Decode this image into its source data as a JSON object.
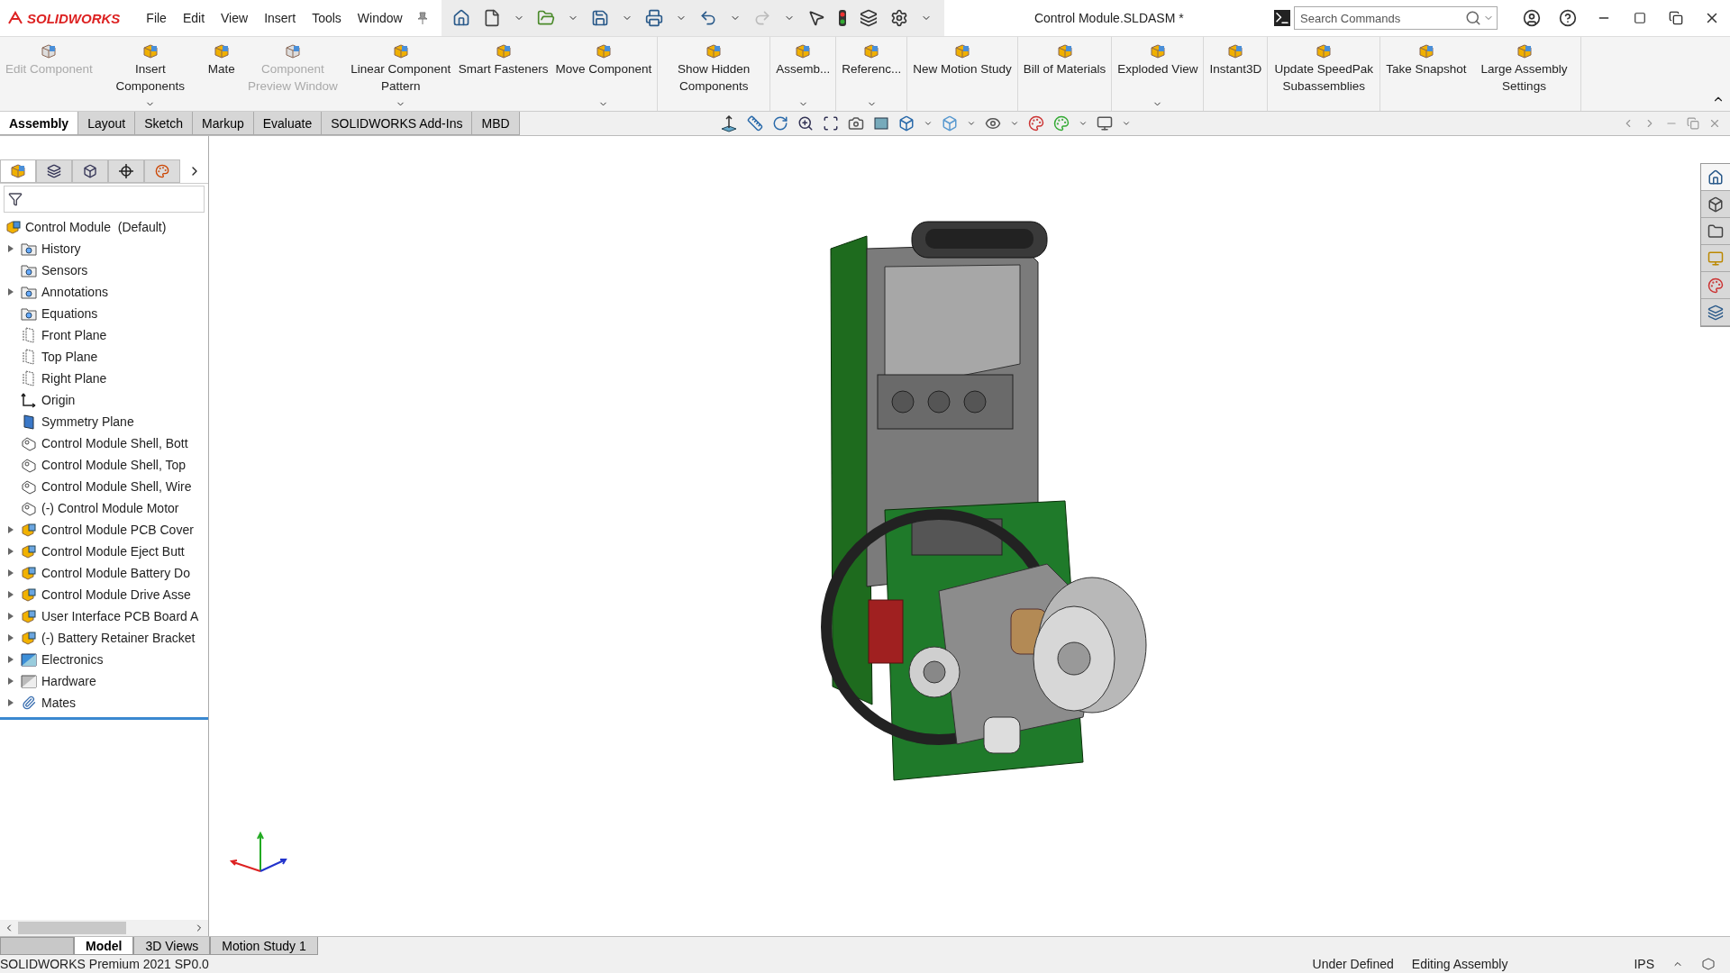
{
  "app": {
    "logo": "SOLIDWORKS",
    "menu": [
      "File",
      "Edit",
      "View",
      "Insert",
      "Tools",
      "Window"
    ],
    "title": "Control Module.SLDASM *"
  },
  "search": {
    "placeholder": "Search Commands"
  },
  "ribbon": [
    [
      {
        "label": "Edit Component",
        "disabled": true,
        "dropdown": false
      },
      {
        "label": "Insert Components",
        "disabled": false,
        "dropdown": true
      },
      {
        "label": "Mate",
        "disabled": false,
        "dropdown": false
      },
      {
        "label": "Component Preview Window",
        "disabled": true,
        "dropdown": false
      },
      {
        "label": "Linear Component Pattern",
        "disabled": false,
        "dropdown": true
      },
      {
        "label": "Smart Fasteners",
        "disabled": false,
        "dropdown": false
      },
      {
        "label": "Move Component",
        "disabled": false,
        "dropdown": true
      }
    ],
    [
      {
        "label": "Show Hidden Components",
        "disabled": false,
        "dropdown": false
      }
    ],
    [
      {
        "label": "Assemb...",
        "disabled": false,
        "dropdown": true
      }
    ],
    [
      {
        "label": "Referenc...",
        "disabled": false,
        "dropdown": true
      }
    ],
    [
      {
        "label": "New Motion Study",
        "disabled": false,
        "dropdown": false
      }
    ],
    [
      {
        "label": "Bill of Materials",
        "disabled": false,
        "dropdown": false
      }
    ],
    [
      {
        "label": "Exploded View",
        "disabled": false,
        "dropdown": true
      }
    ],
    [
      {
        "label": "Instant3D",
        "disabled": false,
        "dropdown": false
      }
    ],
    [
      {
        "label": "Update SpeedPak Subassemblies",
        "disabled": false,
        "dropdown": false
      }
    ],
    [
      {
        "label": "Take Snapshot",
        "disabled": false,
        "dropdown": false
      },
      {
        "label": "Large Assembly Settings",
        "disabled": false,
        "dropdown": false
      }
    ]
  ],
  "tabs": [
    {
      "label": "Assembly",
      "selected": true
    },
    {
      "label": "Layout",
      "selected": false
    },
    {
      "label": "Sketch",
      "selected": false
    },
    {
      "label": "Markup",
      "selected": false
    },
    {
      "label": "Evaluate",
      "selected": false
    },
    {
      "label": "SOLIDWORKS Add-Ins",
      "selected": false
    },
    {
      "label": "MBD",
      "selected": false
    }
  ],
  "panel_tabs": [
    {
      "kind": "tree",
      "selected": true
    },
    {
      "kind": "properties",
      "selected": false
    },
    {
      "kind": "config",
      "selected": false
    },
    {
      "kind": "dim",
      "selected": false
    },
    {
      "kind": "display",
      "selected": false
    }
  ],
  "tree": {
    "label": "Control Module  (Default)",
    "kind": "assembly",
    "children": [
      {
        "label": "History",
        "kind": "folder",
        "expandable": true
      },
      {
        "label": "Sensors",
        "kind": "folder",
        "expandable": false
      },
      {
        "label": "Annotations",
        "kind": "folder",
        "expandable": true
      },
      {
        "label": "Equations",
        "kind": "folder",
        "expandable": false
      },
      {
        "label": "Front Plane",
        "kind": "plane",
        "expandable": false
      },
      {
        "label": "Top Plane",
        "kind": "plane",
        "expandable": false
      },
      {
        "label": "Right Plane",
        "kind": "plane",
        "expandable": false
      },
      {
        "label": "Origin",
        "kind": "origin",
        "expandable": false
      },
      {
        "label": "Symmetry Plane",
        "kind": "refplane",
        "expandable": false
      },
      {
        "label": "Control Module Shell, Bott",
        "kind": "part",
        "expandable": false
      },
      {
        "label": "Control Module Shell, Top",
        "kind": "part",
        "expandable": false
      },
      {
        "label": "Control Module Shell, Wire",
        "kind": "part",
        "expandable": false
      },
      {
        "label": "(-) Control Module Motor",
        "kind": "part",
        "expandable": false
      },
      {
        "label": "Control Module PCB Cover",
        "kind": "subassembly",
        "expandable": true
      },
      {
        "label": "Control Module Eject Butt",
        "kind": "subassembly",
        "expandable": true
      },
      {
        "label": "Control Module Battery Do",
        "kind": "subassembly",
        "expandable": true
      },
      {
        "label": "Control Module Drive Asse",
        "kind": "subassembly",
        "expandable": true
      },
      {
        "label": "User Interface PCB Board A",
        "kind": "subassembly",
        "expandable": true
      },
      {
        "label": "(-) Battery Retainer Bracket",
        "kind": "subassembly",
        "expandable": true
      },
      {
        "label": "Electronics",
        "kind": "colorfolder",
        "expandable": true
      },
      {
        "label": "Hardware",
        "kind": "greyfolder",
        "expandable": true
      },
      {
        "label": "Mates",
        "kind": "mates",
        "expandable": true
      }
    ]
  },
  "bottom_tabs": [
    {
      "label": "Model",
      "selected": true
    },
    {
      "label": "3D Views",
      "selected": false
    },
    {
      "label": "Motion Study 1",
      "selected": false
    }
  ],
  "status_bar": {
    "product": "SOLIDWORKS Premium 2021 SP0.0",
    "state": "Under Defined",
    "mode": "Editing Assembly",
    "units": "IPS"
  }
}
